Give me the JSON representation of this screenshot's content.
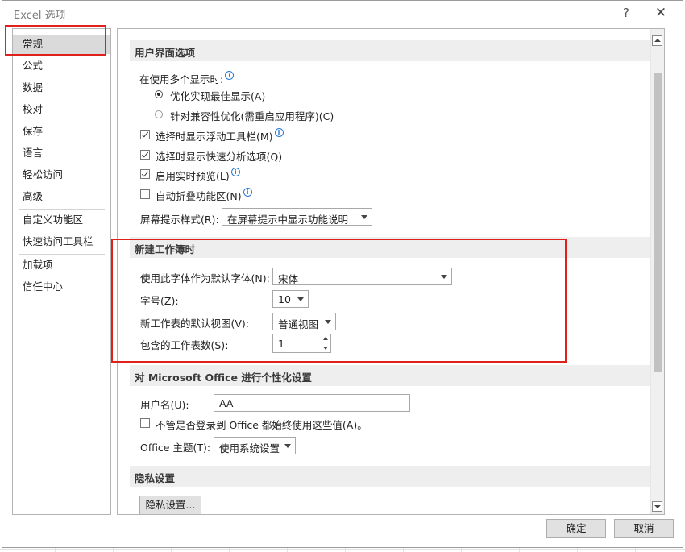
{
  "window": {
    "title": "Excel 选项",
    "help_glyph": "?",
    "close_glyph": "✕"
  },
  "nav": {
    "items": [
      {
        "label": "常规",
        "selected": true
      },
      {
        "label": "公式"
      },
      {
        "label": "数据"
      },
      {
        "label": "校对"
      },
      {
        "label": "保存"
      },
      {
        "label": "语言"
      },
      {
        "label": "轻松访问"
      },
      {
        "label": "高级"
      },
      {
        "label": "自定义功能区"
      },
      {
        "label": "快速访问工具栏"
      },
      {
        "label": "加载项"
      },
      {
        "label": "信任中心"
      }
    ]
  },
  "ui_options": {
    "header": "用户界面选项",
    "multi_display_label": "在使用多个显示时:",
    "radio_best": "优化实现最佳显示(A)",
    "radio_compat": "针对兼容性优化(需重启应用程序)(C)",
    "mini_toolbar": "选择时显示浮动工具栏(M)",
    "quick_analysis": "选择时显示快速分析选项(Q)",
    "live_preview": "启用实时预览(L)",
    "collapse_ribbon": "自动折叠功能区(N)",
    "screentip_label": "屏幕提示样式(R):",
    "screentip_value": "在屏幕提示中显示功能说明"
  },
  "new_workbook": {
    "header": "新建工作簿时",
    "font_label": "使用此字体作为默认字体(N):",
    "font_value": "宋体",
    "size_label": "字号(Z):",
    "size_value": "10",
    "view_label": "新工作表的默认视图(V):",
    "view_value": "普通视图",
    "sheets_label": "包含的工作表数(S):",
    "sheets_value": "1"
  },
  "personalize": {
    "header": "对 Microsoft Office 进行个性化设置",
    "username_label": "用户名(U):",
    "username_value": "AA",
    "always_use": "不管是否登录到 Office 都始终使用这些值(A)。",
    "theme_label": "Office 主题(T):",
    "theme_value": "使用系统设置"
  },
  "privacy": {
    "header": "隐私设置",
    "button": "隐私设置..."
  },
  "footer": {
    "ok": "确定",
    "cancel": "取消"
  },
  "info_glyph": "i",
  "colors": {
    "highlight": "#e0201b",
    "info_blue": "#2b79d0"
  }
}
